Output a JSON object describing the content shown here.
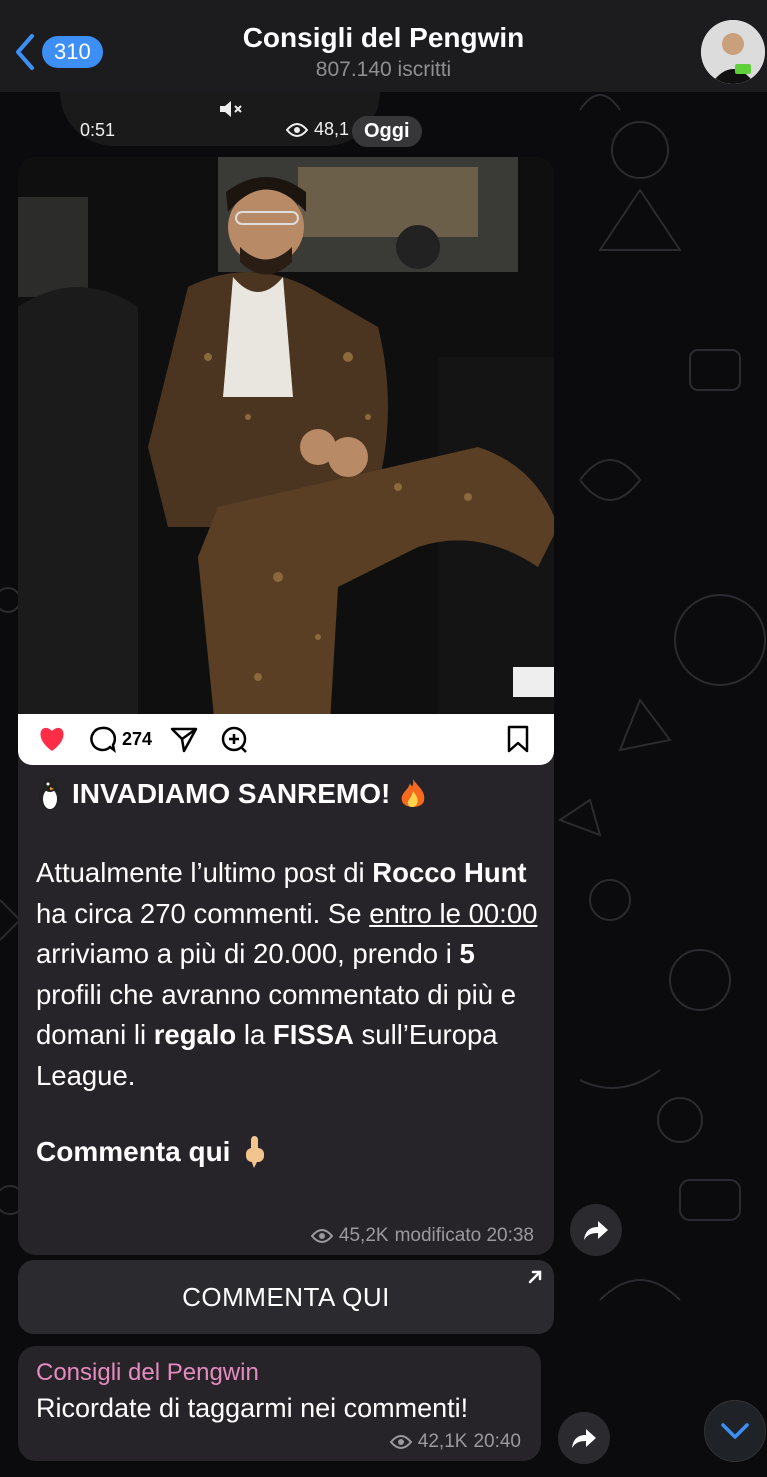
{
  "header": {
    "back_badge": "310",
    "title": "Consigli del Pengwin",
    "subtitle": "807.140 iscritti"
  },
  "previous_post": {
    "duration": "0:51",
    "views": "48,1",
    "date_pill": "Oggi"
  },
  "post": {
    "instagram_comment_count": "274",
    "headline": "INVADIAMO SANREMO!",
    "paragraph": [
      {
        "text": "Attualmente l’ultimo post di ",
        "style": "normal"
      },
      {
        "text": "Rocco Hunt",
        "style": "bold"
      },
      {
        "text": " ha circa 270 commenti. Se ",
        "style": "normal"
      },
      {
        "text": "entro le 00:00",
        "style": "underline"
      },
      {
        "text": " arriviamo a più di 20.000, prendo i ",
        "style": "normal"
      },
      {
        "text": "5",
        "style": "bold"
      },
      {
        "text": " profili che avranno commentato di più e domani li ",
        "style": "normal"
      },
      {
        "text": "regalo",
        "style": "bold"
      },
      {
        "text": " la ",
        "style": "normal"
      },
      {
        "text": "FISSA",
        "style": "bold"
      },
      {
        "text": " sull’Europa League.",
        "style": "normal"
      }
    ],
    "cta": "Commenta qui",
    "views": "45,2K",
    "meta_suffix": "modificato 20:38"
  },
  "inline_button": {
    "label": "COMMENTA QUI"
  },
  "second_post": {
    "author": "Consigli del Pengwin",
    "text": "Ricordate di taggarmi nei commenti!",
    "views": "42,1K",
    "time": "20:40"
  },
  "colors": {
    "accent": "#3d8ff5",
    "author_pink": "#e48bbf",
    "bubble": "#262428",
    "like_red": "#ff2d45"
  },
  "icons": [
    "back-chevron-icon",
    "eye-icon",
    "mute-icon",
    "heart-icon",
    "comment-icon",
    "send-icon",
    "add-comment-icon",
    "bookmark-icon",
    "penguin-icon",
    "fire-icon",
    "pointing-down-icon",
    "forward-icon",
    "external-arrow-icon",
    "chevron-down-icon"
  ]
}
